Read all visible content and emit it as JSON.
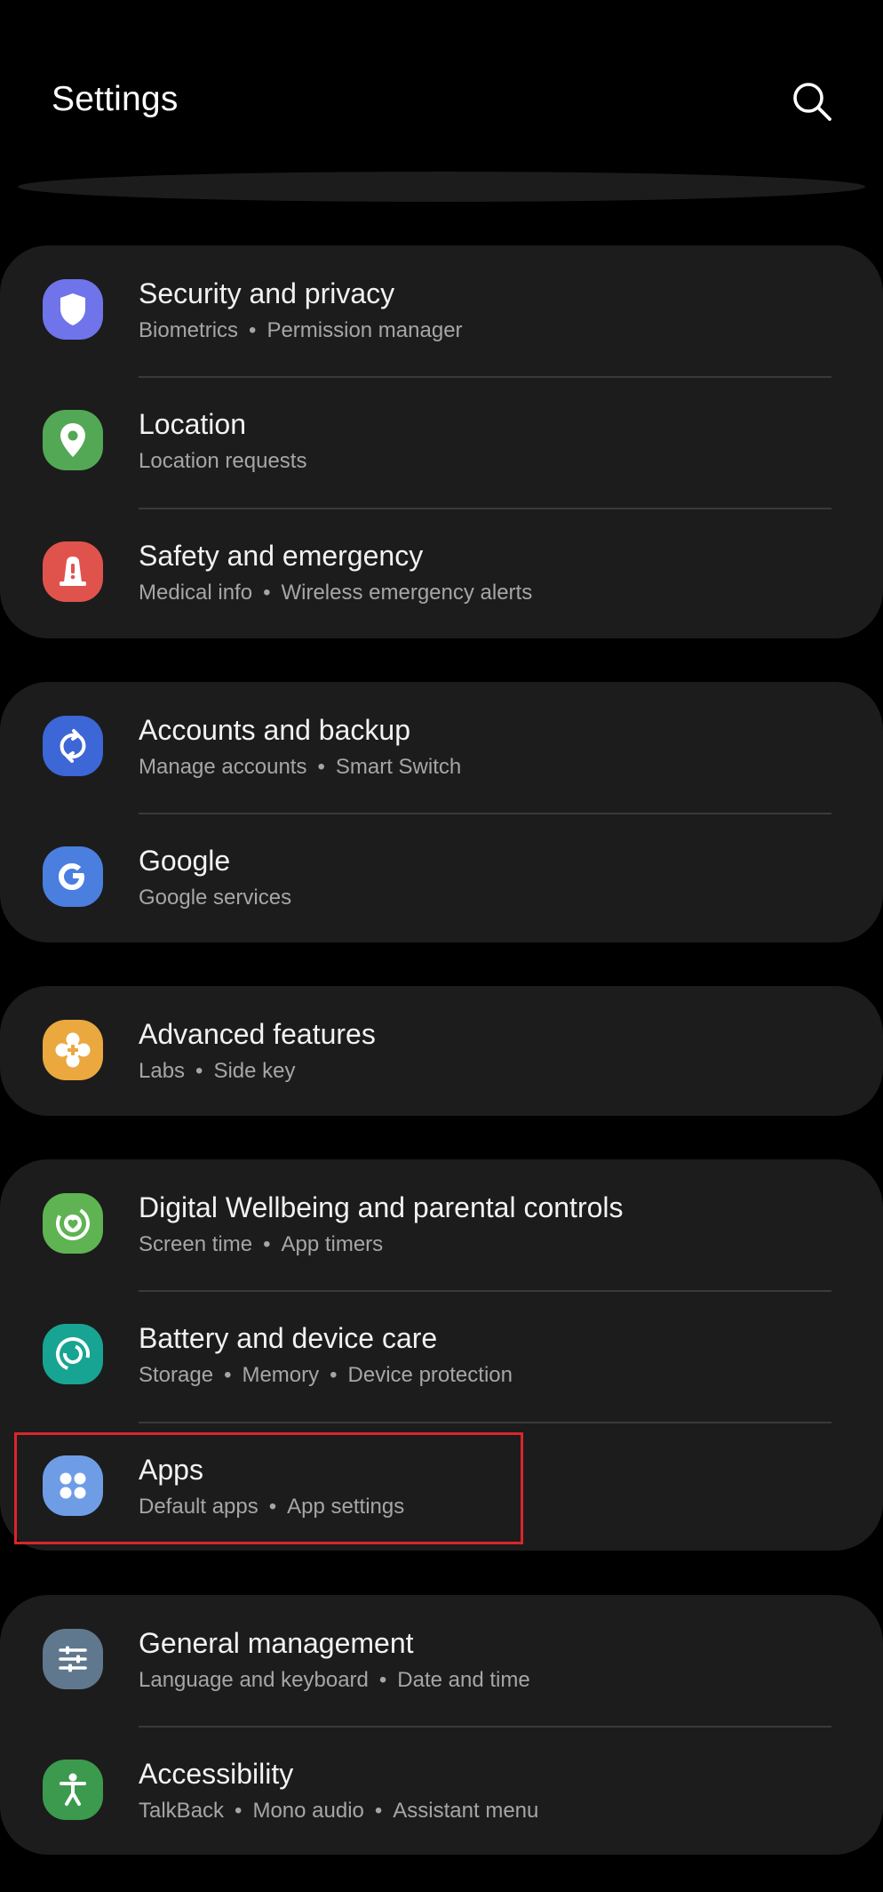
{
  "header": {
    "title": "Settings",
    "search_icon": "search-icon"
  },
  "colors": {
    "background": "#000000",
    "card": "#1c1c1c",
    "highlight": "#d9262b"
  },
  "groups": [
    {
      "items": [
        {
          "label": "Security and privacy",
          "subs": [
            "Biometrics",
            "Permission manager"
          ],
          "icon": "shield-icon",
          "color": "#6f74ea"
        },
        {
          "label": "Location",
          "subs": [
            "Location requests"
          ],
          "icon": "location-pin-icon",
          "color": "#53a855"
        },
        {
          "label": "Safety and emergency",
          "subs": [
            "Medical info",
            "Wireless emergency alerts"
          ],
          "icon": "emergency-alert-icon",
          "color": "#e0534d"
        }
      ]
    },
    {
      "items": [
        {
          "label": "Accounts and backup",
          "subs": [
            "Manage accounts",
            "Smart Switch"
          ],
          "icon": "sync-icon",
          "color": "#3d66d6"
        },
        {
          "label": "Google",
          "subs": [
            "Google services"
          ],
          "icon": "google-icon",
          "color": "#4a7fe0"
        }
      ]
    },
    {
      "items": [
        {
          "label": "Advanced features",
          "subs": [
            "Labs",
            "Side key"
          ],
          "icon": "puzzle-gear-icon",
          "color": "#eaa83f"
        }
      ]
    },
    {
      "items": [
        {
          "label": "Digital Wellbeing and parental controls",
          "subs": [
            "Screen time",
            "App timers"
          ],
          "icon": "wellbeing-heart-icon",
          "color": "#5fb352"
        },
        {
          "label": "Battery and device care",
          "subs": [
            "Storage",
            "Memory",
            "Device protection"
          ],
          "icon": "device-care-icon",
          "color": "#18a493"
        },
        {
          "label": "Apps",
          "subs": [
            "Default apps",
            "App settings"
          ],
          "icon": "apps-grid-icon",
          "color": "#6e9de6",
          "highlighted": true
        }
      ]
    },
    {
      "items": [
        {
          "label": "General management",
          "subs": [
            "Language and keyboard",
            "Date and time"
          ],
          "icon": "sliders-icon",
          "color": "#60788d"
        },
        {
          "label": "Accessibility",
          "subs": [
            "TalkBack",
            "Mono audio",
            "Assistant menu"
          ],
          "icon": "accessibility-icon",
          "color": "#3c9a4e"
        }
      ]
    }
  ]
}
